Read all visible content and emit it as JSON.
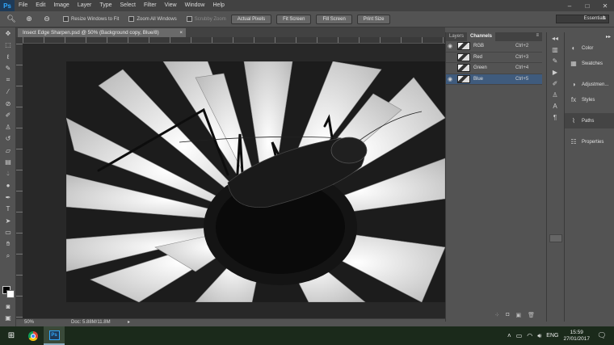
{
  "app": {
    "logo": "Ps",
    "menu": [
      "File",
      "Edit",
      "Image",
      "Layer",
      "Type",
      "Select",
      "Filter",
      "View",
      "Window",
      "Help"
    ],
    "window_controls": [
      "–",
      "□",
      "✕"
    ]
  },
  "options_bar": {
    "resize_windows": "Resize Windows to Fit",
    "zoom_all": "Zoom All Windows",
    "scrubby_zoom": "Scrubby Zoom",
    "actual_pixels": "Actual Pixels",
    "fit_screen": "Fit Screen",
    "fill_screen": "Fill Screen",
    "print_size": "Print Size",
    "workspace": "Essentials"
  },
  "document": {
    "tab_title": "Insect Edge Sharpen.psd @ 50% (Background copy, Blue/8)",
    "tab_close": "×",
    "zoom": "50%",
    "doc_size": "Doc: 5.88M/11.8M"
  },
  "channels_panel": {
    "tabs": [
      "Layers",
      "Channels"
    ],
    "menu_glyph": "≡",
    "rows": [
      {
        "name": "RGB",
        "shortcut": "Ctrl+2",
        "selected": false
      },
      {
        "name": "Red",
        "shortcut": "Ctrl+3",
        "selected": false
      },
      {
        "name": "Green",
        "shortcut": "Ctrl+4",
        "selected": false
      },
      {
        "name": "Blue",
        "shortcut": "Ctrl+5",
        "selected": true
      }
    ]
  },
  "side_panels": [
    "Color",
    "Swatches",
    "Adjustmen...",
    "Styles",
    "Paths",
    "Properties"
  ],
  "taskbar": {
    "language": "ENG",
    "time": "15:59",
    "date": "27/01/2017"
  },
  "icons": {
    "zoom": "zoom-tool-icon",
    "start": "windows-start-icon",
    "chrome": "chrome-icon",
    "photoshop": "photoshop-icon"
  }
}
